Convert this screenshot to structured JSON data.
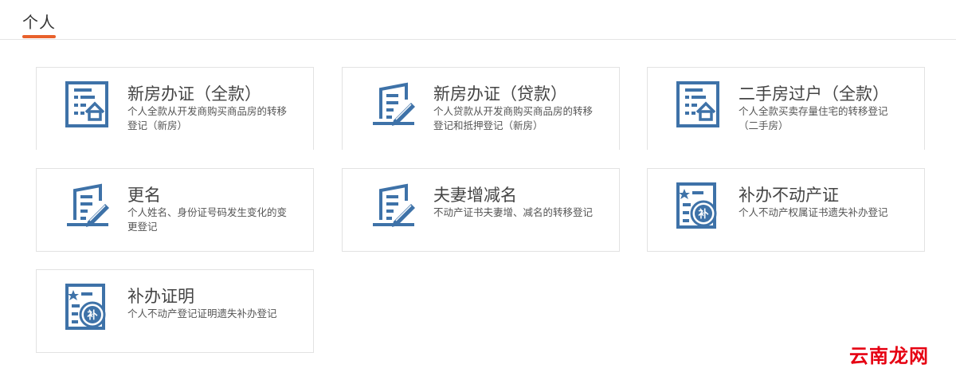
{
  "tab": {
    "label": "个人"
  },
  "colors": {
    "accent": "#e8612c",
    "icon": "#3e72a8",
    "watermark": "#e60012"
  },
  "cards": [
    {
      "title": "新房办证（全款）",
      "desc": "个人全款从开发商购买商品房的转移登记（新房）",
      "icon": "house-certificate-icon"
    },
    {
      "title": "新房办证（贷款）",
      "desc": "个人贷款从开发商购买商品房的转移登记和抵押登记（新房）",
      "icon": "document-pen-icon"
    },
    {
      "title": "二手房过户（全款）",
      "desc": "个人全款买卖存量住宅的转移登记（二手房）",
      "icon": "house-certificate-icon"
    },
    {
      "title": "更名",
      "desc": "个人姓名、身份证号码发生变化的变更登记",
      "icon": "document-pen-icon"
    },
    {
      "title": "夫妻增减名",
      "desc": "不动产证书夫妻增、减名的转移登记",
      "icon": "document-pen-icon"
    },
    {
      "title": "补办不动产证",
      "desc": "个人不动产权属证书遗失补办登记",
      "icon": "certificate-seal-icon"
    },
    {
      "title": "补办证明",
      "desc": "个人不动产登记证明遗失补办登记",
      "icon": "certificate-seal-icon"
    }
  ],
  "watermark": "云南龙网"
}
